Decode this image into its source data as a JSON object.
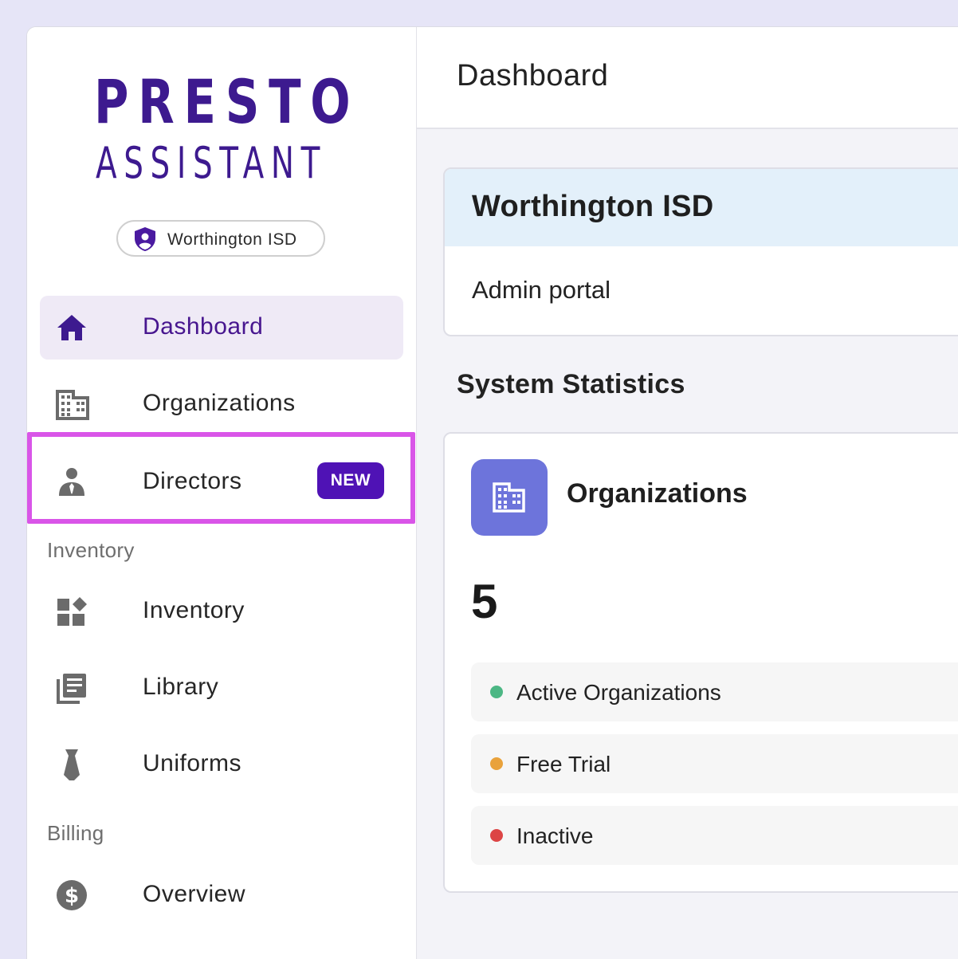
{
  "brand": {
    "line1": "PRESTO",
    "line2": "ASSISTANT",
    "color": "#3d1a8f"
  },
  "org_chip": {
    "icon": "shield-user-icon",
    "label": "Worthington ISD"
  },
  "sidebar": {
    "items": [
      {
        "label": "Dashboard",
        "icon": "home-icon",
        "active": true
      },
      {
        "label": "Organizations",
        "icon": "building-icon"
      },
      {
        "label": "Directors",
        "icon": "director-icon",
        "badge": "NEW",
        "highlighted": true
      }
    ],
    "sections": [
      {
        "title": "Inventory",
        "items": [
          {
            "label": "Inventory",
            "icon": "widgets-icon"
          },
          {
            "label": "Library",
            "icon": "library-icon"
          },
          {
            "label": "Uniforms",
            "icon": "tie-icon"
          }
        ]
      },
      {
        "title": "Billing",
        "items": [
          {
            "label": "Overview",
            "icon": "dollar-icon"
          }
        ]
      }
    ]
  },
  "header": {
    "title": "Dashboard"
  },
  "org_card": {
    "title": "Worthington ISD",
    "subtitle": "Admin portal"
  },
  "stats": {
    "heading": "System Statistics",
    "card": {
      "icon": "building-icon",
      "title": "Organizations",
      "value": "5",
      "statuses": [
        {
          "label": "Active Organizations",
          "color": "#4cb784"
        },
        {
          "label": "Free Trial",
          "color": "#e9a23b"
        },
        {
          "label": "Inactive",
          "color": "#dc4545"
        }
      ]
    }
  },
  "colors": {
    "accent": "#4f12b5",
    "highlight": "#d955e8",
    "active_bg": "#efeaf6",
    "stat_icon_bg": "#6d74db"
  }
}
